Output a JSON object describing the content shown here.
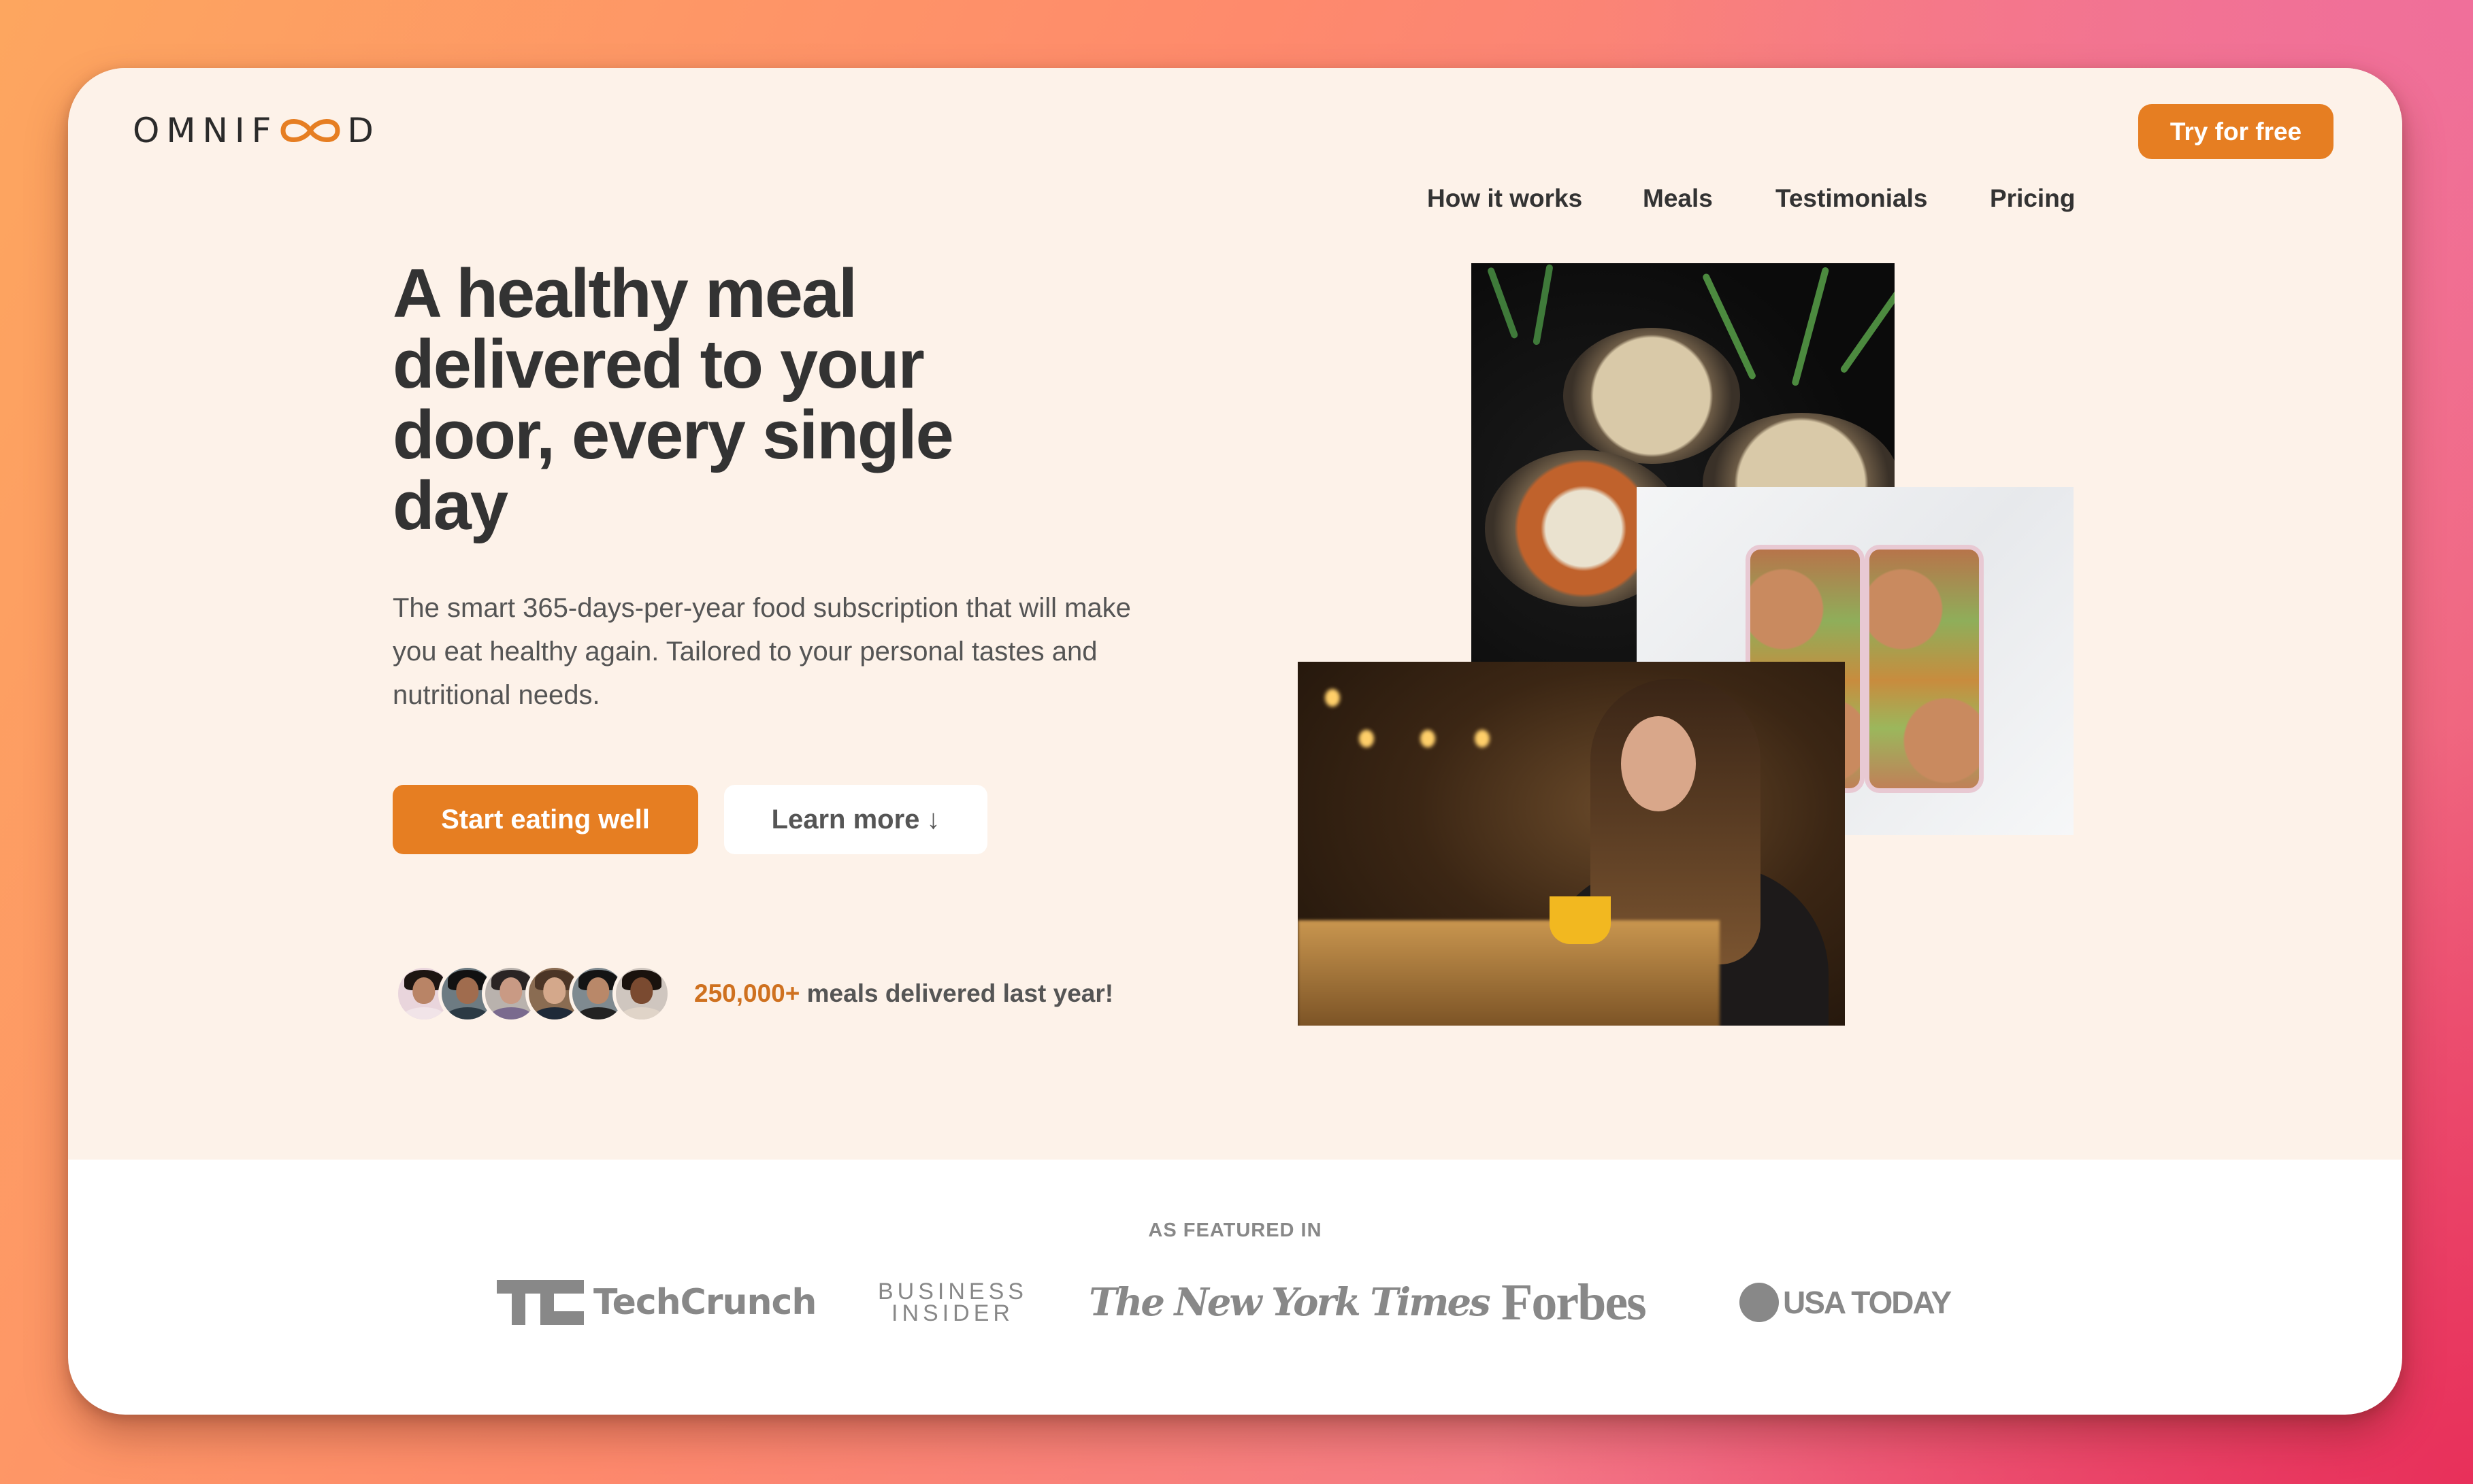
{
  "brand": {
    "logo_text_before": "OMNIF",
    "logo_text_after": "D",
    "logo_icon": "infinity-icon",
    "accent_color": "#e67e22",
    "accent_text_color": "#cf711f"
  },
  "nav": {
    "links": [
      {
        "label": "How it works"
      },
      {
        "label": "Meals"
      },
      {
        "label": "Testimonials"
      },
      {
        "label": "Pricing"
      }
    ],
    "cta_label": "Try for free"
  },
  "hero": {
    "headline": "A healthy meal delivered to your door, every single day",
    "description": "The smart 365-days-per-year food subscription that will make you eat healthy again. Tailored to your personal tastes and nutritional needs.",
    "primary_button": "Start eating well",
    "secondary_button": "Learn more",
    "secondary_button_icon": "↓",
    "delivered_count": "250,000+",
    "delivered_text": "meals delivered last year!",
    "customer_avatars": [
      {
        "name": "customer-1"
      },
      {
        "name": "customer-2"
      },
      {
        "name": "customer-3"
      },
      {
        "name": "customer-4"
      },
      {
        "name": "customer-5"
      },
      {
        "name": "customer-6"
      }
    ],
    "images": [
      {
        "name": "bowls-photo",
        "alt": "Three bowls of healthy meals"
      },
      {
        "name": "lunchbox-photo",
        "alt": "Meal prep boxes with chickpeas and avocado"
      },
      {
        "name": "woman-eating-photo",
        "alt": "Woman enjoying a meal in a cafe"
      }
    ]
  },
  "featured": {
    "title": "AS FEATURED IN",
    "logos": [
      {
        "name": "TechCrunch",
        "mark": "TC",
        "text": "TechCrunch"
      },
      {
        "name": "Business Insider",
        "line1": "BUSINESS",
        "line2": "INSIDER"
      },
      {
        "name": "The New York Times",
        "text": "The New York Times"
      },
      {
        "name": "Forbes",
        "text": "Forbes"
      },
      {
        "name": "USA Today",
        "text": "USA TODAY"
      }
    ]
  }
}
